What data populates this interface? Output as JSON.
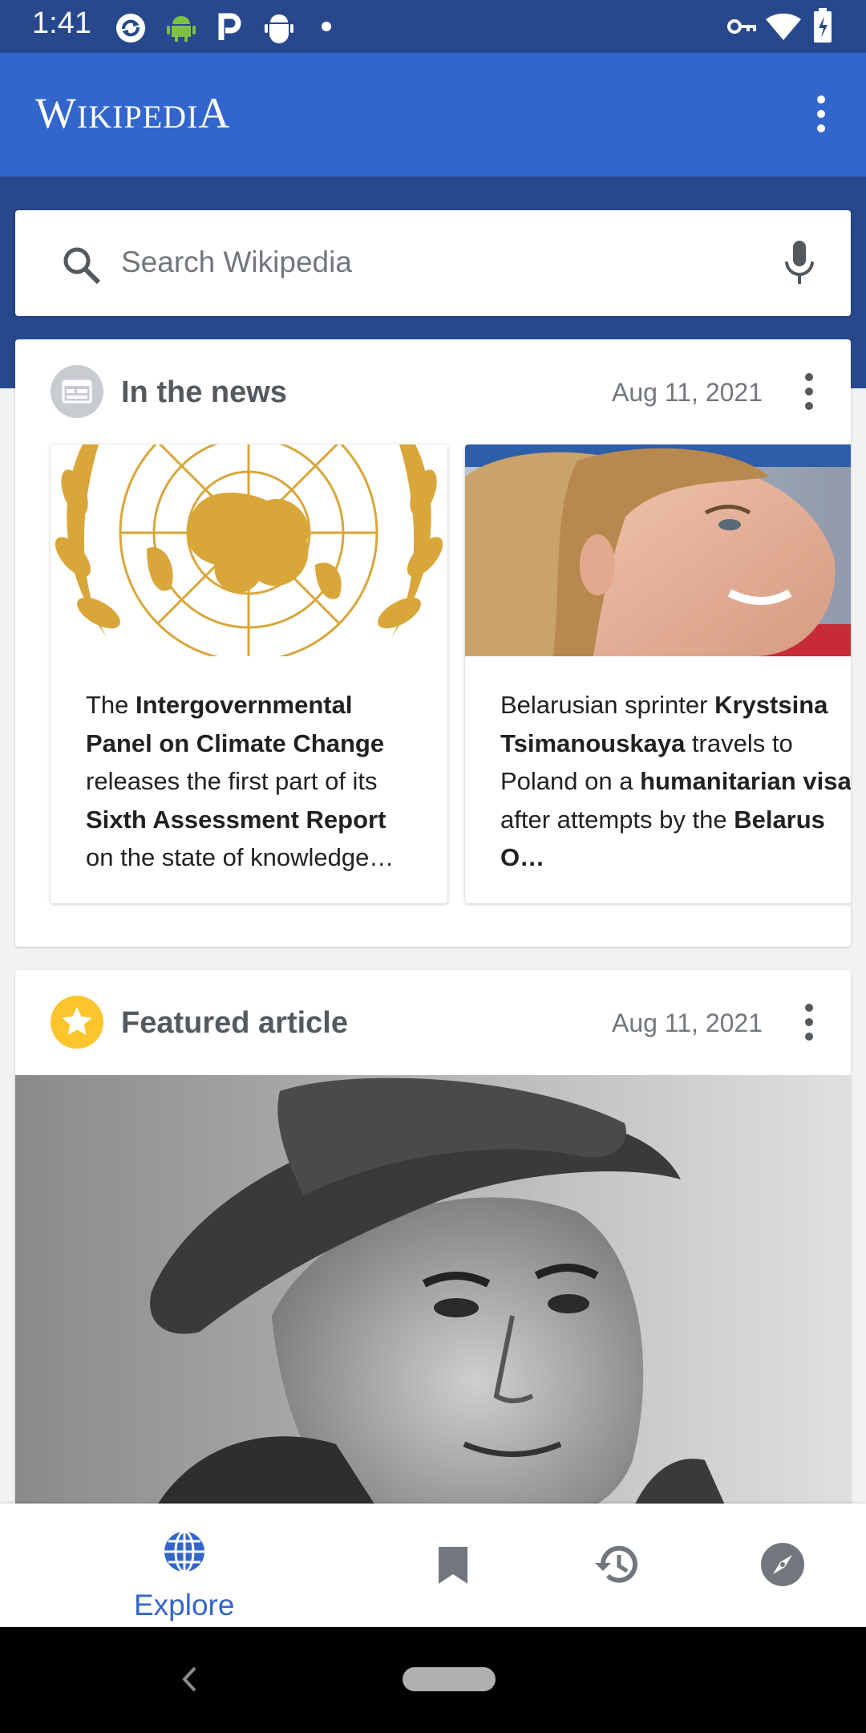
{
  "status_bar": {
    "time": "1:41",
    "icons": [
      "sync-icon",
      "android-icon",
      "parking-icon",
      "android-debug-icon",
      "dot-icon",
      "vpn-key-icon",
      "wifi-icon",
      "battery-icon"
    ]
  },
  "app_bar": {
    "logo": "Wikipedia",
    "menu_icon": "more-vert-icon"
  },
  "search": {
    "placeholder": "Search Wikipedia",
    "icon": "search-icon",
    "voice_icon": "mic-icon"
  },
  "news_card": {
    "title": "In the news",
    "date": "Aug 11, 2021",
    "icon": "news-icon",
    "items": [
      {
        "image": "un-emblem",
        "segments": [
          {
            "t": "The ",
            "b": false
          },
          {
            "t": "Intergovernmental Panel on Climate Change",
            "b": true
          },
          {
            "t": " releases the first part of its ",
            "b": false
          },
          {
            "t": "Sixth Assessment Report",
            "b": true
          },
          {
            "t": " on the state of knowledge…",
            "b": false
          }
        ]
      },
      {
        "image": "portrait-sprinter",
        "segments": [
          {
            "t": "Belarusian sprinter ",
            "b": false
          },
          {
            "t": "Krystsina Tsimanouskaya",
            "b": true
          },
          {
            "t": " travels to Poland on a ",
            "b": false
          },
          {
            "t": "humanitarian visa",
            "b": true
          },
          {
            "t": " after attempts by the ",
            "b": false
          },
          {
            "t": "Belarus O…",
            "b": true
          }
        ]
      }
    ]
  },
  "featured_card": {
    "title": "Featured article",
    "date": "Aug 11, 2021",
    "icon": "star-icon",
    "image": "portrait-soldier"
  },
  "bottom_nav": {
    "items": [
      {
        "label": "Explore",
        "icon": "globe-icon",
        "active": true
      },
      {
        "label": "",
        "icon": "bookmark-icon",
        "active": false
      },
      {
        "label": "",
        "icon": "history-icon",
        "active": false
      },
      {
        "label": "",
        "icon": "compass-icon",
        "active": false
      }
    ]
  },
  "colors": {
    "primary": "#3366cc",
    "primary_dark": "#27488c",
    "star": "#fdc52c",
    "emblem_gold": "#d9a63a"
  }
}
